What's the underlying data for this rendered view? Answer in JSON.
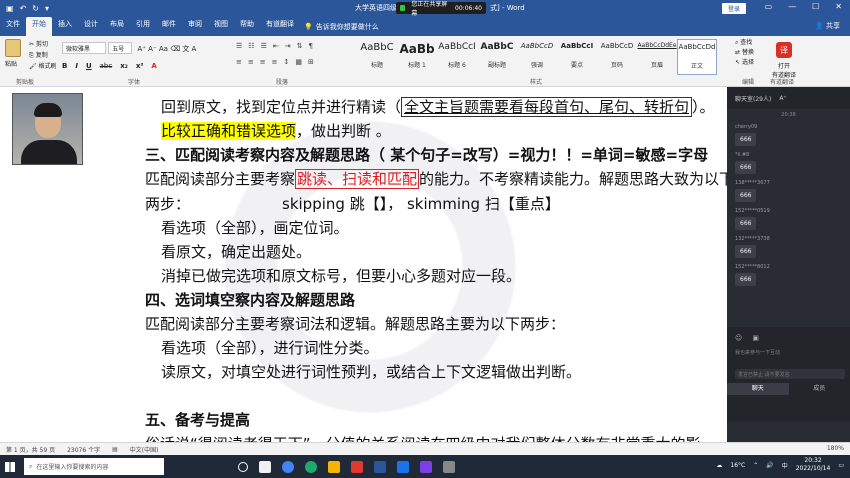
{
  "window": {
    "title": "大学英语四级(...",
    "title_suffix": "式] - Word",
    "share_pill_text": "您正在共享屏幕",
    "share_pill_time": "00:06:40",
    "login_label": "登录"
  },
  "tabs": [
    "文件",
    "开始",
    "插入",
    "设计",
    "布局",
    "引用",
    "邮件",
    "审阅",
    "视图",
    "帮助",
    "有道翻译"
  ],
  "active_tab": "开始",
  "tell_me": "告诉我你想要做什么",
  "share_label": "共享",
  "ribbon": {
    "clipboard": {
      "paste": "粘贴",
      "cut": "剪切",
      "copy": "复制",
      "format_painter": "格式刷",
      "label": "剪贴板"
    },
    "font": {
      "name": "微软雅黑",
      "size": "五号",
      "label": "字体",
      "buttons": [
        "B",
        "I",
        "U",
        "abc",
        "x₂",
        "x²",
        "A"
      ]
    },
    "paragraph": {
      "label": "段落"
    },
    "styles": {
      "label": "样式",
      "items": [
        {
          "sample": "AaBbC",
          "name": "标题"
        },
        {
          "sample": "AaBb",
          "name": "标题 1"
        },
        {
          "sample": "AaBbCcI",
          "name": "标题 6"
        },
        {
          "sample": "AaBbC",
          "name": "副标题"
        },
        {
          "sample": "AaBbCcD",
          "name": "强调"
        },
        {
          "sample": "AaBbCcI",
          "name": "要点"
        },
        {
          "sample": "AaBbCcD",
          "name": "页码"
        },
        {
          "sample": "AaBbCcDdEe",
          "name": "页眉"
        },
        {
          "sample": "AaBbCcDd",
          "name": "正文"
        }
      ]
    },
    "editing": {
      "find": "查找",
      "replace": "替换",
      "select": "选择",
      "label": "编辑"
    },
    "youdao": {
      "line1": "打开",
      "line2": "有道翻译",
      "label": "有道翻译"
    }
  },
  "document": {
    "l1_a": "回到原文，找到定位点并进行精读（",
    "l1_b": "全文主旨题需要看每段首句、尾句、转折句",
    "l1_c": "）。",
    "l2_a": "比较正确和错误选项",
    "l2_b": "，做出判断 。",
    "l3": "三、匹配阅读考察内容及解题思路（ 某个句子=改写）=视力！！=单词=敏感=字母",
    "l4_a": "匹配阅读部分主要考察",
    "l4_b": "跳读、扫读和匹配",
    "l4_c": "的能力。不考察精读能力。解题思路大致为以下",
    "l5_a": "两步：",
    "l5_b": "skipping 跳【】，  skimming 扫【重点】",
    "l6": "看选项（全部），画定位词。",
    "l7": "看原文，确定出题处。",
    "l8": "消掉已做完选项和原文标号，但要小心多题对应一段。",
    "l9": "四、选词填空察内容及解题思路",
    "l10": "匹配阅读部分主要考察词法和逻辑。解题思路主要为以下两步：",
    "l11": "看选项（全部），进行词性分类。",
    "l12": "读原文，对填空处进行词性预判，或结合上下文逻辑做出判断。",
    "l13": "五、备考与提高",
    "l14": "俗话说“得阅读者得天下”，分值的关系阅读在四级中对我们整体分数有非常重大的影"
  },
  "chat": {
    "header": "聊天室(29人)",
    "font_btn": "A⁺",
    "time": "20:38",
    "messages": [
      {
        "user": "cherry09",
        "text": "666"
      },
      {
        "user": "*li.#8",
        "text": "666"
      },
      {
        "user": "138*****3677",
        "text": "666"
      },
      {
        "user": "152*****0519",
        "text": "666"
      },
      {
        "user": "132*****3738",
        "text": "666"
      },
      {
        "user": "152*****8012",
        "text": "666"
      }
    ],
    "placeholder": "我也来参与一下互动",
    "send_placeholder": "发言已禁止 请不要发言",
    "tab_chat": "聊天",
    "tab_members": "成员"
  },
  "status": {
    "page": "第 1 页，共 59 页",
    "words": "23076 个字",
    "lang": "中文(中国)",
    "zoom": "180%"
  },
  "taskbar": {
    "search": "在这里输入你要搜索的内容",
    "weather": "16°C",
    "ime": "中",
    "time": "20:32",
    "date": "2022/10/14"
  },
  "colors": {
    "accent": "#2b579a",
    "highlight": "#ffff00",
    "red_box": "#d7262b"
  }
}
